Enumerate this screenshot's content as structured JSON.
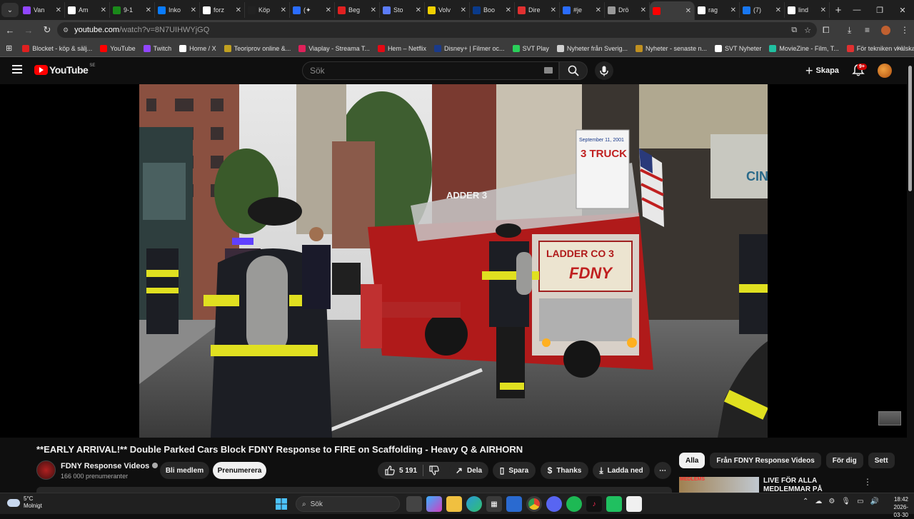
{
  "tabs": [
    {
      "label": "Van",
      "color": "#9146ff"
    },
    {
      "label": "Am",
      "color": "#ffffff"
    },
    {
      "label": "9-1",
      "color": "#1a8a1a"
    },
    {
      "label": "Inko",
      "color": "#0a7cff"
    },
    {
      "label": "forz",
      "color": "#ffffff"
    },
    {
      "label": "Köp",
      "color": "#222222"
    },
    {
      "label": "(✦",
      "color": "#2a6cff"
    },
    {
      "label": "Beg",
      "color": "#e02020"
    },
    {
      "label": "Sto",
      "color": "#5b7cfa"
    },
    {
      "label": "Volv",
      "color": "#f0d000"
    },
    {
      "label": "Boo",
      "color": "#0a3a8a"
    },
    {
      "label": "Dire",
      "color": "#e03030"
    },
    {
      "label": "#je",
      "color": "#2a6cff"
    },
    {
      "label": "Drö",
      "color": "#999999"
    },
    {
      "label": "",
      "color": "#ff0000",
      "active": true
    },
    {
      "label": "rag",
      "color": "#ffffff"
    },
    {
      "label": "(7)",
      "color": "#1877f2"
    },
    {
      "label": "lind",
      "color": "#ffffff"
    }
  ],
  "address": {
    "host": "youtube.com",
    "path": "/watch?v=8N7UIHWYjGQ"
  },
  "bookmarks": [
    {
      "label": "Blocket - köp & sälj...",
      "color": "#e02020"
    },
    {
      "label": "YouTube",
      "color": "#ff0000"
    },
    {
      "label": "Twitch",
      "color": "#9146ff"
    },
    {
      "label": "Home / X",
      "color": "#ffffff"
    },
    {
      "label": "Teoriprov online &...",
      "color": "#c0a020"
    },
    {
      "label": "Viaplay - Streama T...",
      "color": "#e0205a"
    },
    {
      "label": "Hem – Netflix",
      "color": "#e50914"
    },
    {
      "label": "Disney+ | Filmer oc...",
      "color": "#1a3a8a"
    },
    {
      "label": "SVT Play",
      "color": "#2ad05a"
    },
    {
      "label": "Nyheter från Sverig...",
      "color": "#d0d0d0"
    },
    {
      "label": "Nyheter - senaste n...",
      "color": "#c09020"
    },
    {
      "label": "SVT Nyheter",
      "color": "#ffffff"
    },
    {
      "label": "MovieZine - Film, T...",
      "color": "#20c0a0"
    },
    {
      "label": "För tekniken vi älska...",
      "color": "#e03030"
    }
  ],
  "youtube": {
    "logo_text": "YouTube",
    "country": "SE",
    "search_placeholder": "Sök",
    "create_label": "Skapa",
    "notif_count": "9+"
  },
  "video": {
    "title": "**EARLY ARRIVAL!** Double Parked Cars Block FDNY Response to FIRE on Scaffolding - Heavy Q & AIRHORN",
    "channel": "FDNY Response Videos",
    "subscribers": "166 000 prenumeranter",
    "join_label": "Bli medlem",
    "subscribe_label": "Prenumerera",
    "likes": "5 191",
    "share_label": "Dela",
    "save_label": "Spara",
    "thanks_label": "Thanks",
    "download_label": "Ladda ned",
    "scene_truck_text": "LADDER CO 3",
    "scene_fdny": "FDNY",
    "scene_sign_top": "September 11, 2001",
    "scene_sign_mid": "3 TRUCK",
    "scene_ladder": "ADDER 3",
    "scene_cinema": "CIN"
  },
  "chips": [
    {
      "label": "Alla",
      "active": true
    },
    {
      "label": "Från FDNY Response Videos"
    },
    {
      "label": "För dig"
    },
    {
      "label": "Sett"
    }
  ],
  "side": {
    "badge": "MEDLEMS",
    "title": "LIVE FÖR ALLA MEDLEMMAR PÅ KANALEN"
  },
  "taskbar": {
    "temp": "5°C",
    "weather": "Molnigt",
    "search": "Sök",
    "time": "18:42",
    "date": "2026-03-30"
  }
}
